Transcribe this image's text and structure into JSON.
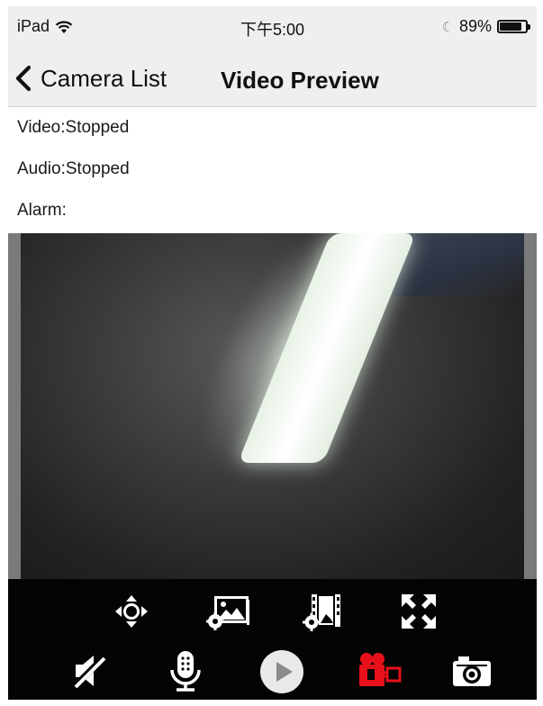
{
  "status": {
    "device": "iPad",
    "time": "下午5:00",
    "battery": "89%",
    "battery_level": 0.89
  },
  "nav": {
    "back_label": "Camera List",
    "title": "Video Preview"
  },
  "info": {
    "video": "Video:Stopped",
    "audio": "Audio:Stopped",
    "alarm": "Alarm:"
  },
  "toolbar_top": [
    "ptz-direction-icon",
    "image-settings-icon",
    "video-settings-icon",
    "fullscreen-icon"
  ],
  "toolbar_bottom": [
    "mute-speaker-icon",
    "microphone-icon",
    "play-icon",
    "record-video-icon",
    "snapshot-camera-icon"
  ],
  "colors": {
    "record_active": "#e8101a",
    "toolbar_bg": "#040404",
    "nav_bg": "#efefef"
  }
}
